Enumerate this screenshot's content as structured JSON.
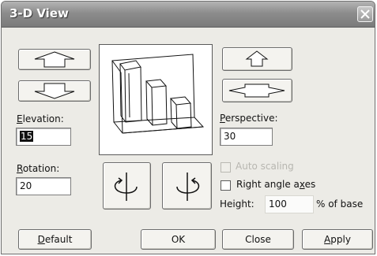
{
  "window": {
    "title": "3-D View"
  },
  "elevation": {
    "label_u": "E",
    "label_rest": "levation:",
    "value": "15"
  },
  "rotation": {
    "label_u": "R",
    "label_rest": "otation:",
    "value": "20"
  },
  "perspective": {
    "label_u": "P",
    "label_rest": "erspective:",
    "value": "30"
  },
  "auto_scaling": {
    "label": "Auto scaling",
    "checked": false,
    "enabled": false
  },
  "right_angle_axes": {
    "label_pre": "Right angle a",
    "label_u": "x",
    "label_post": "es",
    "checked": false
  },
  "height": {
    "label": "Height:",
    "value": "100",
    "suffix": "% of base"
  },
  "buttons": {
    "default_u": "D",
    "default_rest": "efault",
    "ok": "OK",
    "close": "Close",
    "apply_u": "A",
    "apply_rest": "pply"
  },
  "icons": {
    "elevation_up": "arrow-up-icon",
    "elevation_down": "arrow-down-icon",
    "rotate_left": "rotate-left-icon",
    "rotate_right": "rotate-right-icon",
    "perspective_up": "perspective-increase-icon",
    "perspective_down": "perspective-decrease-icon"
  }
}
